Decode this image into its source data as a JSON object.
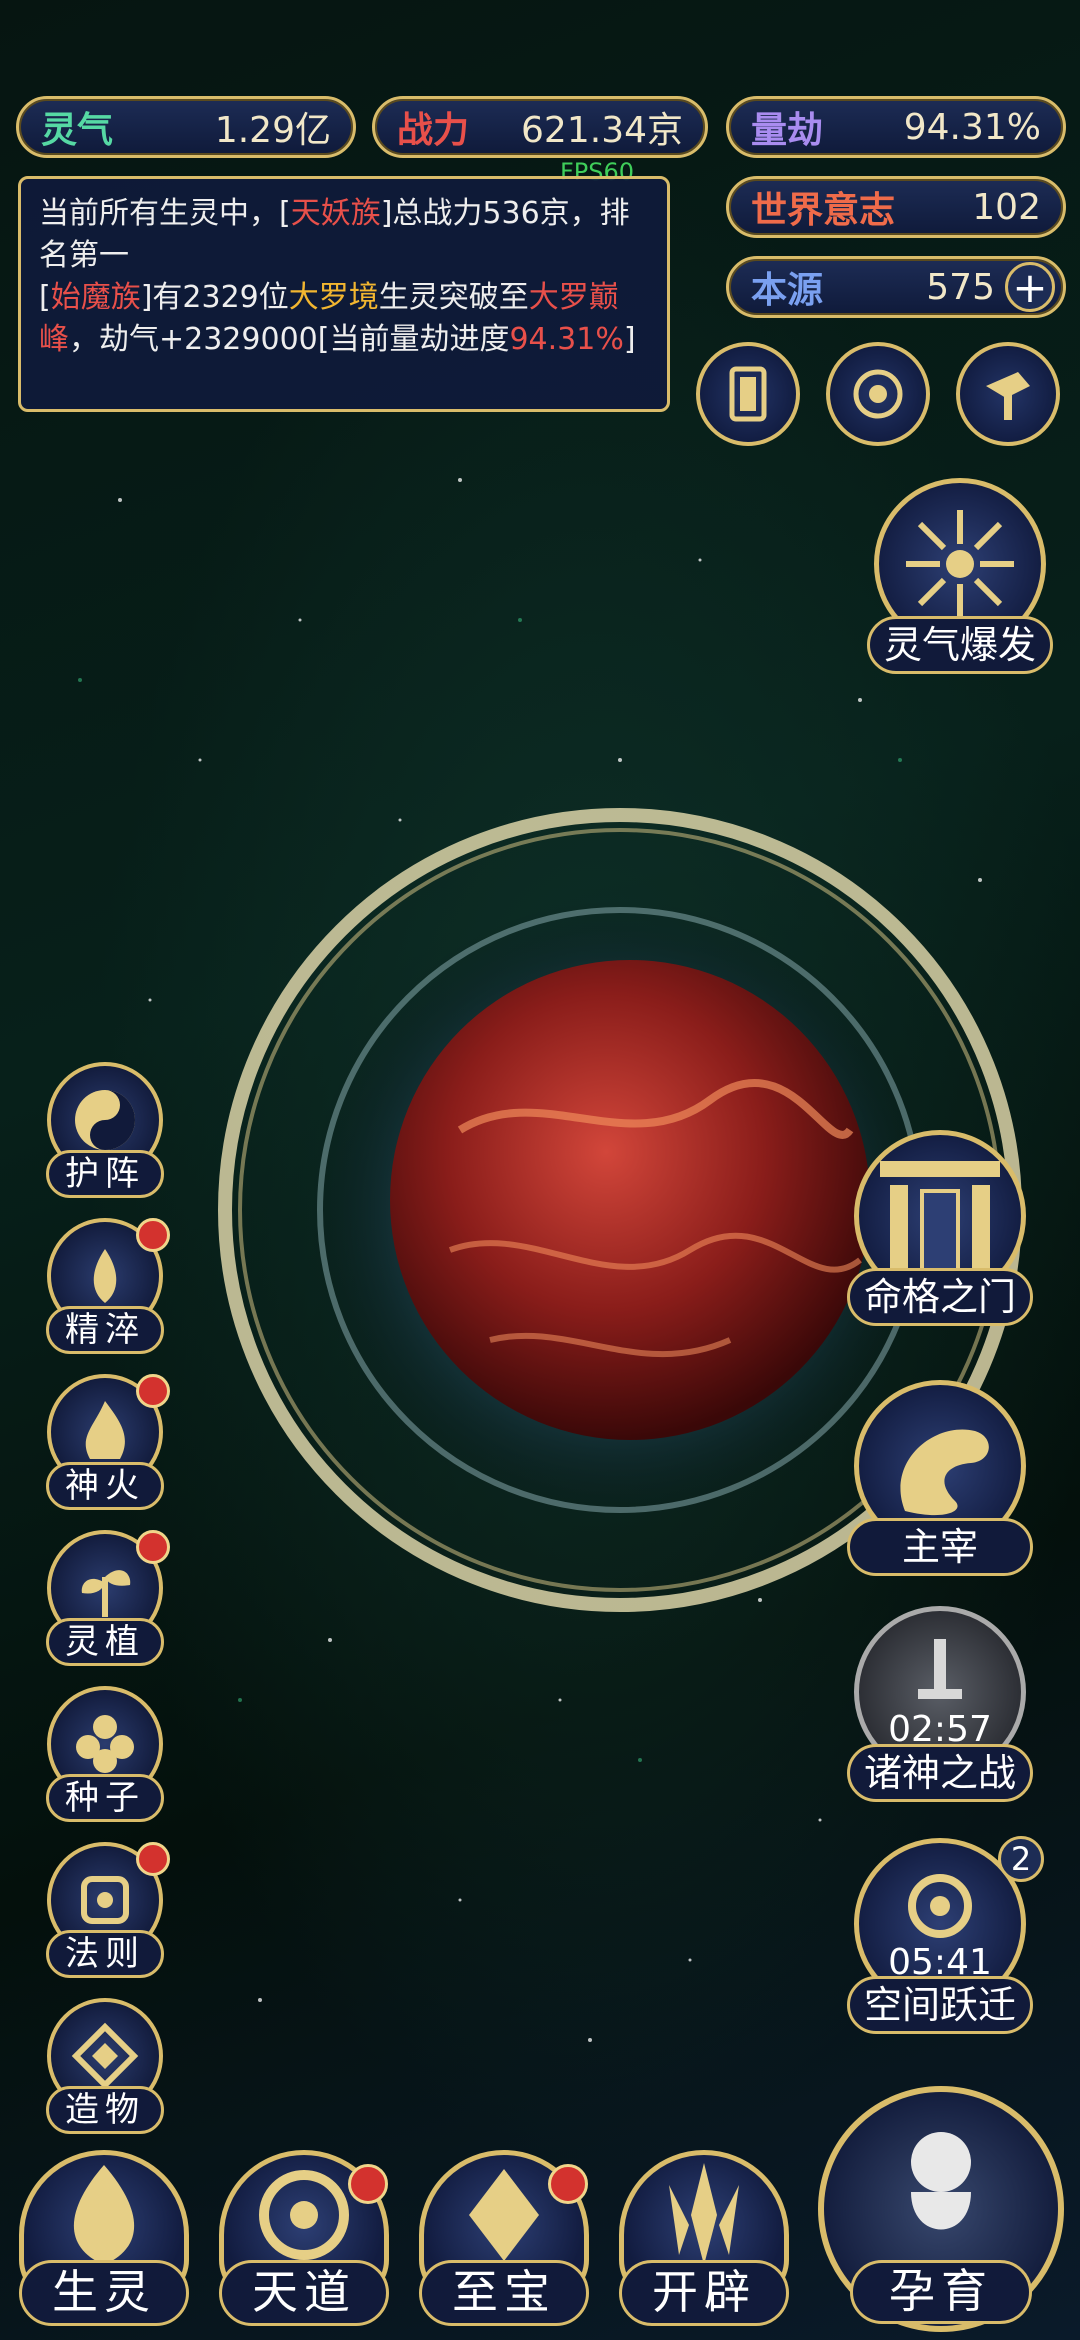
{
  "hud": {
    "lingqi": {
      "label": "灵气",
      "value": "1.29亿"
    },
    "zhanli": {
      "label": "战力",
      "value": "621.34京"
    },
    "liangjie": {
      "label": "量劫",
      "value": "94.31%"
    },
    "shijie": {
      "label": "世界意志",
      "value": "102"
    },
    "benyuan": {
      "label": "本源",
      "value": "575"
    },
    "fps": "FPS60"
  },
  "log": {
    "line1_a": "当前所有生灵中，[",
    "line1_race": "天妖族",
    "line1_b": "]总战力536京，排名第一",
    "line2_a": "[",
    "line2_race": "始魔族",
    "line2_b": "]有2329位",
    "line2_realm": "大罗境",
    "line2_c": "生灵突破至",
    "line2_peak": "大罗巅峰",
    "line2_d": "，劫气+2329000[当前量劫进度",
    "line2_pct": "94.31%",
    "line2_e": "]"
  },
  "right_buttons": {
    "burst": {
      "label": "灵气爆发"
    },
    "gate": {
      "label": "命格之门"
    },
    "master": {
      "label": "主宰"
    },
    "war": {
      "label": "诸神之战",
      "timer": "02:57"
    },
    "leap": {
      "label": "空间跃迁",
      "timer": "05:41",
      "badge": "2"
    }
  },
  "left_buttons": [
    {
      "label": "护阵"
    },
    {
      "label": "精淬"
    },
    {
      "label": "神火"
    },
    {
      "label": "灵植"
    },
    {
      "label": "种子"
    },
    {
      "label": "法则"
    },
    {
      "label": "造物"
    }
  ],
  "bottom_nav": [
    {
      "label": "生灵"
    },
    {
      "label": "天道"
    },
    {
      "label": "至宝"
    },
    {
      "label": "开辟"
    }
  ],
  "breed": {
    "label": "孕育"
  },
  "colors": {
    "gold": "#d9bc6a",
    "panel": "#121c40",
    "red_text": "#e8504a",
    "gold_text": "#f2b630"
  }
}
